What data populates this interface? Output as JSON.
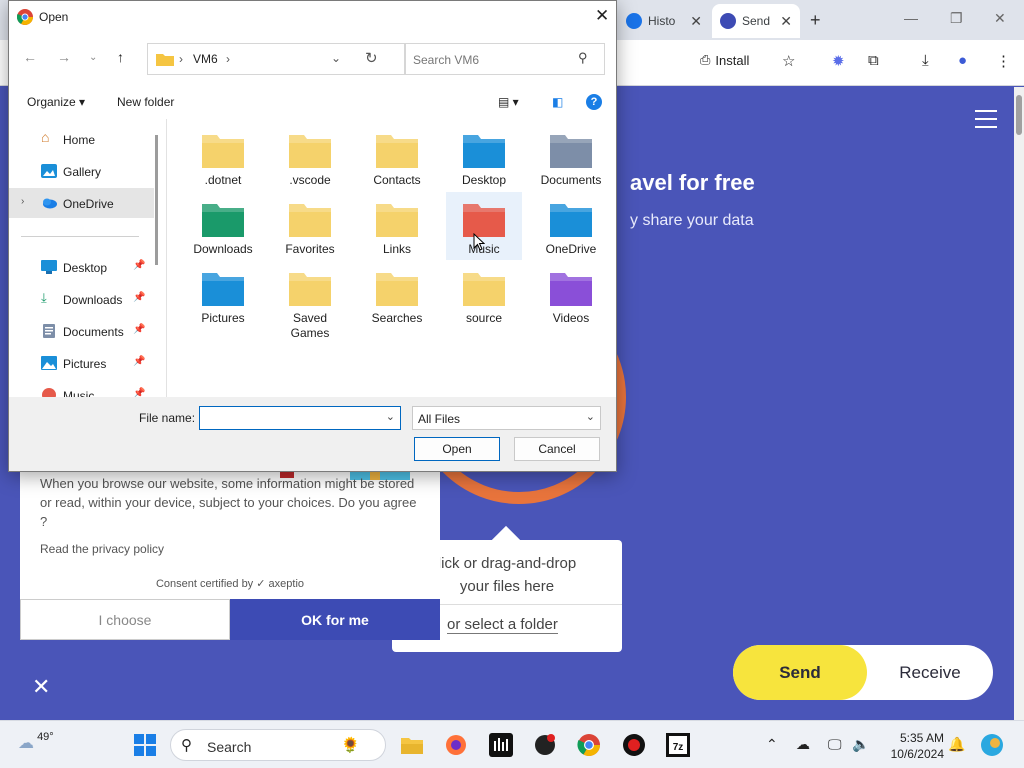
{
  "browser": {
    "tabs": [
      {
        "label": "Histo",
        "active": false
      },
      {
        "label": "Send",
        "active": true
      }
    ],
    "toolbar": {
      "install_label": "Install"
    }
  },
  "page": {
    "hero_title": "avel for free",
    "hero_sub": "y share your data",
    "drop_text_line1": "lick or drag-and-drop",
    "drop_text_line2": "your files here",
    "select_folder": "or select a folder",
    "send_label": "Send",
    "receive_label": "Receive",
    "consent": {
      "text": "When you browse our website, some information might be stored or read, within your device, subject to your choices. Do you agree ?",
      "privacy": "Read the privacy policy",
      "certified": "Consent certified by",
      "brand": "axeptio",
      "choose": "I choose",
      "ok": "OK for me"
    }
  },
  "dialog": {
    "title": "Open",
    "breadcrumb": [
      "VM6"
    ],
    "search_placeholder": "Search VM6",
    "organize_label": "Organize",
    "new_folder_label": "New folder",
    "nav": {
      "home": "Home",
      "gallery": "Gallery",
      "onedrive": "OneDrive",
      "desktop": "Desktop",
      "downloads": "Downloads",
      "documents": "Documents",
      "pictures": "Pictures",
      "music": "Music"
    },
    "files": [
      {
        "name": ".dotnet",
        "color": "#f5d26b"
      },
      {
        "name": ".vscode",
        "color": "#f5d26b"
      },
      {
        "name": "Contacts",
        "color": "#f5d26b"
      },
      {
        "name": "Desktop",
        "color": "#1a8fd8"
      },
      {
        "name": "Documents",
        "color": "#7d8ea8"
      },
      {
        "name": "Downloads",
        "color": "#1a9a6a"
      },
      {
        "name": "Favorites",
        "color": "#f5d26b"
      },
      {
        "name": "Links",
        "color": "#f5d26b"
      },
      {
        "name": "Music",
        "color": "#e65a4a"
      },
      {
        "name": "OneDrive",
        "color": "#1a8fd8"
      },
      {
        "name": "Pictures",
        "color": "#1a8fd8"
      },
      {
        "name": "Saved Games",
        "color": "#f5d26b"
      },
      {
        "name": "Searches",
        "color": "#f5d26b"
      },
      {
        "name": "source",
        "color": "#f5d26b"
      },
      {
        "name": "Videos",
        "color": "#8a4fd8"
      }
    ],
    "file_name_label": "File name:",
    "file_name_value": "",
    "file_type": "All Files",
    "open_label": "Open",
    "cancel_label": "Cancel"
  },
  "taskbar": {
    "temperature": "49°",
    "search_label": "Search",
    "time": "5:35 AM",
    "date": "10/6/2024"
  }
}
